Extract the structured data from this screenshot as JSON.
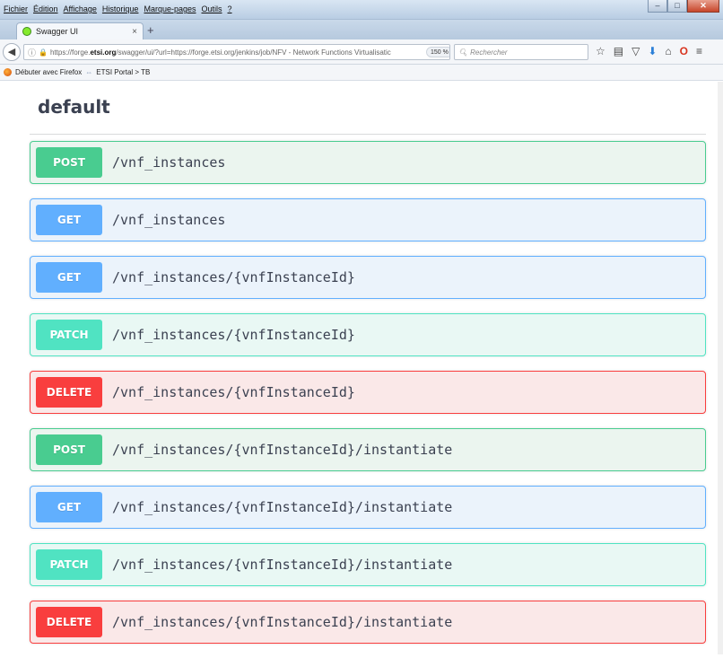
{
  "browser": {
    "menu": [
      "Fichier",
      "Édition",
      "Affichage",
      "Historique",
      "Marque-pages",
      "Outils",
      "?"
    ],
    "tab_title": "Swagger UI",
    "url_prefix": "https://forge.",
    "url_domain": "etsi.org",
    "url_rest": "/swagger/ui/?url=https://forge.etsi.org/jenkins/job/NFV - Network Functions Virtualisatic",
    "zoom": "150 %",
    "search_placeholder": "Rechercher",
    "bookmarks": [
      "Débuter avec Firefox",
      "ETSI Portal > TB"
    ]
  },
  "page": {
    "section_title": "default",
    "operations": [
      {
        "method": "POST",
        "path": "/vnf_instances"
      },
      {
        "method": "GET",
        "path": "/vnf_instances"
      },
      {
        "method": "GET",
        "path": "/vnf_instances/{vnfInstanceId}"
      },
      {
        "method": "PATCH",
        "path": "/vnf_instances/{vnfInstanceId}"
      },
      {
        "method": "DELETE",
        "path": "/vnf_instances/{vnfInstanceId}"
      },
      {
        "method": "POST",
        "path": "/vnf_instances/{vnfInstanceId}/instantiate"
      },
      {
        "method": "GET",
        "path": "/vnf_instances/{vnfInstanceId}/instantiate"
      },
      {
        "method": "PATCH",
        "path": "/vnf_instances/{vnfInstanceId}/instantiate"
      },
      {
        "method": "DELETE",
        "path": "/vnf_instances/{vnfInstanceId}/instantiate"
      }
    ]
  },
  "colors": {
    "post": "#49cc90",
    "get": "#61affe",
    "patch": "#50e3c2",
    "delete": "#f93e3e"
  }
}
